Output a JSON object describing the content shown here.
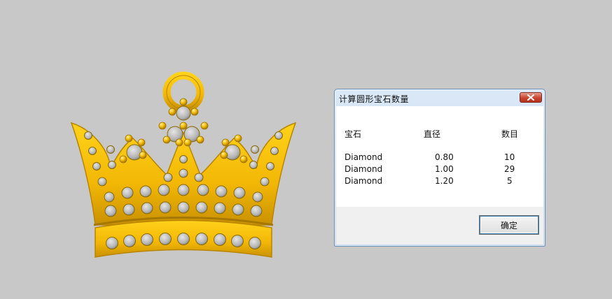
{
  "dialog": {
    "title": "计算圆形宝石数量",
    "headers": {
      "gem": "宝石",
      "diameter": "直径",
      "count": "数目"
    },
    "rows": [
      {
        "gem": "Diamond",
        "diameter": "0.80",
        "count": "10"
      },
      {
        "gem": "Diamond",
        "diameter": "1.00",
        "count": "29"
      },
      {
        "gem": "Diamond",
        "diameter": "1.20",
        "count": "5"
      }
    ],
    "ok_label": "确定",
    "close_icon": "close-icon"
  },
  "viewport": {
    "object": "crown-pendant-model",
    "colors": {
      "gold": "#f2b705",
      "gold_dark": "#b98500",
      "stone": "#b9b9b9",
      "background": "#c8c8c8"
    }
  }
}
